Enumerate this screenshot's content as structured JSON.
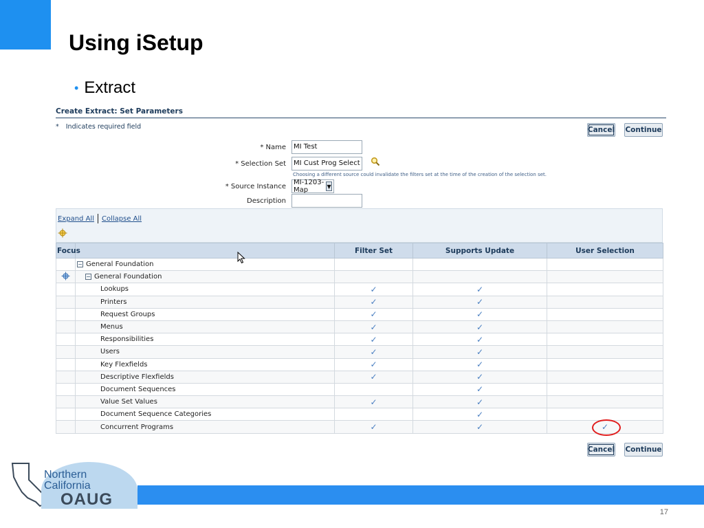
{
  "slide": {
    "title": "Using iSetup",
    "bullet": "Extract",
    "page_number": "17"
  },
  "app": {
    "page_title": "Create Extract: Set Parameters",
    "required_note_star": "*",
    "required_note": "Indicates required field",
    "cancel_label": "Cancel",
    "continue_label": "Continue",
    "form": {
      "name_label": "* Name",
      "name_value": "MI Test",
      "selection_set_label": "* Selection Set",
      "selection_set_value": "MI Cust Prog Select",
      "selection_hint": "Choosing a different source could invalidate the filters set at the time of the creation of the selection set.",
      "source_instance_label": "* Source Instance",
      "source_instance_value": "MI-1203-Map",
      "description_label": "Description",
      "description_value": ""
    },
    "toolbar": {
      "expand_all": "Expand All",
      "collapse_all": "Collapse All"
    },
    "columns": [
      "Focus",
      "",
      "Filter Set",
      "Supports Update",
      "User Selection"
    ],
    "tree": [
      {
        "name": "General Foundation",
        "level": 0,
        "toggle": "−",
        "focus": false,
        "filter_set": false,
        "supports_update": false,
        "user_selection": false
      },
      {
        "name": "General Foundation",
        "level": 1,
        "toggle": "−",
        "focus": true,
        "filter_set": false,
        "supports_update": false,
        "user_selection": false
      },
      {
        "name": "Lookups",
        "level": 2,
        "filter_set": true,
        "supports_update": true,
        "user_selection": false
      },
      {
        "name": "Printers",
        "level": 2,
        "filter_set": true,
        "supports_update": true,
        "user_selection": false
      },
      {
        "name": "Request Groups",
        "level": 2,
        "filter_set": true,
        "supports_update": true,
        "user_selection": false
      },
      {
        "name": "Menus",
        "level": 2,
        "filter_set": true,
        "supports_update": true,
        "user_selection": false
      },
      {
        "name": "Responsibilities",
        "level": 2,
        "filter_set": true,
        "supports_update": true,
        "user_selection": false
      },
      {
        "name": "Users",
        "level": 2,
        "filter_set": true,
        "supports_update": true,
        "user_selection": false
      },
      {
        "name": "Key Flexfields",
        "level": 2,
        "filter_set": true,
        "supports_update": true,
        "user_selection": false
      },
      {
        "name": "Descriptive Flexfields",
        "level": 2,
        "filter_set": true,
        "supports_update": true,
        "user_selection": false
      },
      {
        "name": "Document Sequences",
        "level": 2,
        "filter_set": false,
        "supports_update": true,
        "user_selection": false
      },
      {
        "name": "Value Set Values",
        "level": 2,
        "filter_set": true,
        "supports_update": true,
        "user_selection": false
      },
      {
        "name": "Document Sequence Categories",
        "level": 2,
        "filter_set": false,
        "supports_update": true,
        "user_selection": false
      },
      {
        "name": "Concurrent Programs",
        "level": 2,
        "filter_set": true,
        "supports_update": true,
        "user_selection": true,
        "highlighted": true
      }
    ],
    "check_glyph": "✓"
  },
  "logo": {
    "line1": "Northern",
    "line2": "California",
    "line3": "OAUG"
  },
  "colors": {
    "accent_blue": "#1e90f0",
    "header_navy": "#1c3a5a",
    "check_blue": "#4a7fc1",
    "highlight_red": "#e01b1b"
  }
}
